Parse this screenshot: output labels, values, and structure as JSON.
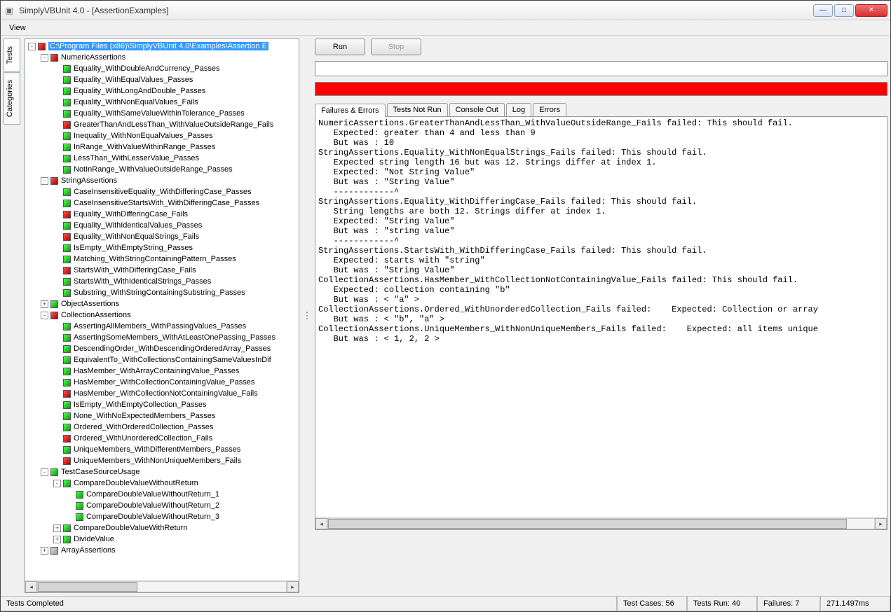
{
  "window": {
    "title": "SimplyVBUnit 4.0 - [AssertionExamples]"
  },
  "menu": {
    "view": "View"
  },
  "side_tabs": {
    "tests": "Tests",
    "categories": "Categories"
  },
  "toolbar": {
    "run": "Run",
    "stop": "Stop"
  },
  "result_tabs": {
    "failures": "Failures & Errors",
    "notrun": "Tests Not Run",
    "console": "Console Out",
    "log": "Log",
    "errors": "Errors"
  },
  "tree": {
    "root": {
      "label": "C:\\Program Files (x86)\\SimplyVBUnit 4.0\\Examples\\Assertion E",
      "status": "red",
      "indent": 0,
      "exp": "-",
      "selected": true
    },
    "nodes": [
      {
        "label": "NumericAssertions",
        "status": "red",
        "indent": 1,
        "exp": "-"
      },
      {
        "label": "Equality_WithDoubleAndCurrency_Passes",
        "status": "green",
        "indent": 2
      },
      {
        "label": "Equality_WithEqualValues_Passes",
        "status": "green",
        "indent": 2
      },
      {
        "label": "Equality_WithLongAndDouble_Passes",
        "status": "green",
        "indent": 2
      },
      {
        "label": "Equality_WithNonEqualValues_Fails",
        "status": "green",
        "indent": 2
      },
      {
        "label": "Equality_WithSameValueWithinTolerance_Passes",
        "status": "green",
        "indent": 2
      },
      {
        "label": "GreaterThanAndLessThan_WithValueOutsideRange_Fails",
        "status": "red",
        "indent": 2
      },
      {
        "label": "Inequality_WithNonEqualValues_Passes",
        "status": "green",
        "indent": 2
      },
      {
        "label": "InRange_WithValueWithinRange_Passes",
        "status": "green",
        "indent": 2
      },
      {
        "label": "LessThan_WithLesserValue_Passes",
        "status": "green",
        "indent": 2
      },
      {
        "label": "NotInRange_WithValueOutsideRange_Passes",
        "status": "green",
        "indent": 2
      },
      {
        "label": "StringAssertions",
        "status": "red",
        "indent": 1,
        "exp": "-"
      },
      {
        "label": "CaseInsensitiveEquality_WithDifferingCase_Passes",
        "status": "green",
        "indent": 2
      },
      {
        "label": "CaseInsensitiveStartsWith_WithDifferingCase_Passes",
        "status": "green",
        "indent": 2
      },
      {
        "label": "Equality_WithDifferingCase_Fails",
        "status": "red",
        "indent": 2
      },
      {
        "label": "Equality_WithIdenticalValues_Passes",
        "status": "green",
        "indent": 2
      },
      {
        "label": "Equality_WithNonEqualStrings_Fails",
        "status": "red",
        "indent": 2
      },
      {
        "label": "IsEmpty_WithEmptyString_Passes",
        "status": "green",
        "indent": 2
      },
      {
        "label": "Matching_WithStringContainingPattern_Passes",
        "status": "green",
        "indent": 2
      },
      {
        "label": "StartsWith_WithDifferingCase_Fails",
        "status": "red",
        "indent": 2
      },
      {
        "label": "StartsWith_WithIdenticalStrings_Passes",
        "status": "green",
        "indent": 2
      },
      {
        "label": "Substring_WithStringContainingSubstring_Passes",
        "status": "green",
        "indent": 2
      },
      {
        "label": "ObjectAssertions",
        "status": "green",
        "indent": 1,
        "exp": "+"
      },
      {
        "label": "CollectionAssertions",
        "status": "red",
        "indent": 1,
        "exp": "-"
      },
      {
        "label": "AssertingAllMembers_WithPassingValues_Passes",
        "status": "green",
        "indent": 2
      },
      {
        "label": "AssertingSomeMembers_WithAtLeastOnePassing_Passes",
        "status": "green",
        "indent": 2
      },
      {
        "label": "DescendingOrder_WithDescendingOrderedArray_Passes",
        "status": "green",
        "indent": 2
      },
      {
        "label": "EquivalentTo_WithCollectionsContainingSameValuesInDif",
        "status": "green",
        "indent": 2
      },
      {
        "label": "HasMember_WithArrayContainingValue_Passes",
        "status": "green",
        "indent": 2
      },
      {
        "label": "HasMember_WithCollectionContainingValue_Passes",
        "status": "green",
        "indent": 2
      },
      {
        "label": "HasMember_WithCollectionNotContainingValue_Fails",
        "status": "red",
        "indent": 2
      },
      {
        "label": "IsEmpty_WithEmptyCollection_Passes",
        "status": "green",
        "indent": 2
      },
      {
        "label": "None_WithNoExpectedMembers_Passes",
        "status": "green",
        "indent": 2
      },
      {
        "label": "Ordered_WithOrderedCollection_Passes",
        "status": "green",
        "indent": 2
      },
      {
        "label": "Ordered_WithUnorderedCollection_Fails",
        "status": "red",
        "indent": 2
      },
      {
        "label": "UniqueMembers_WithDifferentMembers_Passes",
        "status": "green",
        "indent": 2
      },
      {
        "label": "UniqueMembers_WithNonUniqueMembers_Fails",
        "status": "red",
        "indent": 2
      },
      {
        "label": "TestCaseSourceUsage",
        "status": "green",
        "indent": 1,
        "exp": "-"
      },
      {
        "label": "CompareDoubleValueWithoutReturn",
        "status": "green",
        "indent": 2,
        "exp": "-"
      },
      {
        "label": "CompareDoubleValueWithoutReturn_1",
        "status": "green",
        "indent": 3
      },
      {
        "label": "CompareDoubleValueWithoutReturn_2",
        "status": "green",
        "indent": 3
      },
      {
        "label": "CompareDoubleValueWithoutReturn_3",
        "status": "green",
        "indent": 3
      },
      {
        "label": "CompareDoubleValueWithReturn",
        "status": "green",
        "indent": 2,
        "exp": "+"
      },
      {
        "label": "DivideValue",
        "status": "green",
        "indent": 2,
        "exp": "+"
      },
      {
        "label": "ArrayAssertions",
        "status": "gray",
        "indent": 1,
        "exp": "+"
      }
    ]
  },
  "output_text": "NumericAssertions.GreaterThanAndLessThan_WithValueOutsideRange_Fails failed: This should fail.\n   Expected: greater than 4 and less than 9\n   But was : 10\nStringAssertions.Equality_WithNonEqualStrings_Fails failed: This should fail.\n   Expected string length 16 but was 12. Strings differ at index 1.\n   Expected: \"Not String Value\"\n   But was : \"String Value\"\n   ------------^\nStringAssertions.Equality_WithDifferingCase_Fails failed: This should fail.\n   String lengths are both 12. Strings differ at index 1.\n   Expected: \"String Value\"\n   But was : \"string value\"\n   ------------^\nStringAssertions.StartsWith_WithDifferingCase_Fails failed: This should fail.\n   Expected: starts with \"string\"\n   But was : \"String Value\"\nCollectionAssertions.HasMember_WithCollectionNotContainingValue_Fails failed: This should fail.\n   Expected: collection containing \"b\"\n   But was : < \"a\" >\nCollectionAssertions.Ordered_WithUnorderedCollection_Fails failed:    Expected: Collection or array\n   But was : < \"b\", \"a\" >\nCollectionAssertions.UniqueMembers_WithNonUniqueMembers_Fails failed:    Expected: all items unique\n   But was : < 1, 2, 2 >",
  "status": {
    "completed": "Tests Completed",
    "cases": "Test Cases: 56",
    "run": "Tests Run: 40",
    "failures": "Failures: 7",
    "time": "271.1497ms"
  }
}
